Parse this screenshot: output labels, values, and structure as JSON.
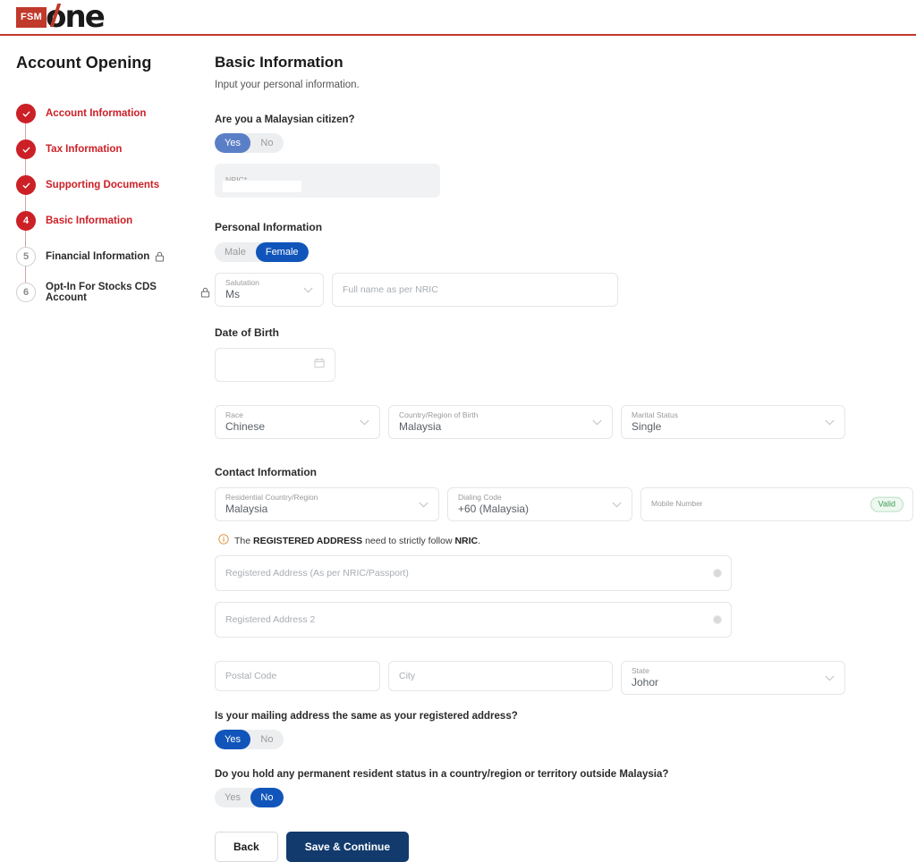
{
  "brand": {
    "mark": "FSM",
    "name": "one",
    "accent_color": "#c0392b"
  },
  "sidebar": {
    "title": "Account Opening",
    "steps": [
      {
        "marker": "check",
        "label": "Account Information",
        "state": "done",
        "locked": false
      },
      {
        "marker": "check",
        "label": "Tax Information",
        "state": "done",
        "locked": false
      },
      {
        "marker": "check",
        "label": "Supporting Documents",
        "state": "done",
        "locked": false
      },
      {
        "marker": "4",
        "label": "Basic Information",
        "state": "current",
        "locked": false
      },
      {
        "marker": "5",
        "label": "Financial Information",
        "state": "locked",
        "locked": true
      },
      {
        "marker": "6",
        "label": "Opt-In For Stocks CDS Account",
        "state": "locked",
        "locked": true
      }
    ]
  },
  "main": {
    "title": "Basic Information",
    "subtitle": "Input your personal information.",
    "citizen": {
      "question": "Are you a Malaysian citizen?",
      "options": [
        "Yes",
        "No"
      ],
      "selected": "Yes"
    },
    "nric": {
      "label": "NRIC*",
      "value": ""
    },
    "personal": {
      "heading": "Personal Information",
      "gender": {
        "options": [
          "Male",
          "Female"
        ],
        "selected": "Female"
      },
      "salutation": {
        "label": "Salutation",
        "value": "Ms"
      },
      "full_name": {
        "placeholder": "Full name as per NRIC",
        "value": ""
      }
    },
    "dob": {
      "heading": "Date of Birth",
      "value": ""
    },
    "race": {
      "label": "Race",
      "value": "Chinese"
    },
    "country_of_birth": {
      "label": "Country/Region of Birth",
      "value": "Malaysia"
    },
    "marital_status": {
      "label": "Marital Status",
      "value": "Single"
    },
    "contact": {
      "heading": "Contact Information",
      "residential_country": {
        "label": "Residential Country/Region",
        "value": "Malaysia"
      },
      "dialing_code": {
        "label": "Dialing Code",
        "value": "+60 (Malaysia)"
      },
      "mobile_number": {
        "label": "Mobile Number",
        "value": "",
        "badge": "Valid"
      }
    },
    "address_note": {
      "prefix": "The ",
      "bold1": "REGISTERED ADDRESS",
      "middle": " need to strictly follow ",
      "bold2": "NRIC",
      "suffix": "."
    },
    "address1": {
      "placeholder": "Registered Address (As per NRIC/Passport)",
      "value": ""
    },
    "address2": {
      "placeholder": "Registered Address 2",
      "value": ""
    },
    "postal_code": {
      "placeholder": "Postal Code",
      "value": ""
    },
    "city": {
      "placeholder": "City",
      "value": ""
    },
    "state": {
      "label": "State",
      "value": "Johor"
    },
    "mailing_same": {
      "question": "Is your mailing address the same as your registered address?",
      "options": [
        "Yes",
        "No"
      ],
      "selected": "Yes"
    },
    "pr_status": {
      "question": "Do you hold any permanent resident status in a country/region or territory outside Malaysia?",
      "options": [
        "Yes",
        "No"
      ],
      "selected": "No"
    },
    "buttons": {
      "back": "Back",
      "save": "Save & Continue"
    }
  }
}
